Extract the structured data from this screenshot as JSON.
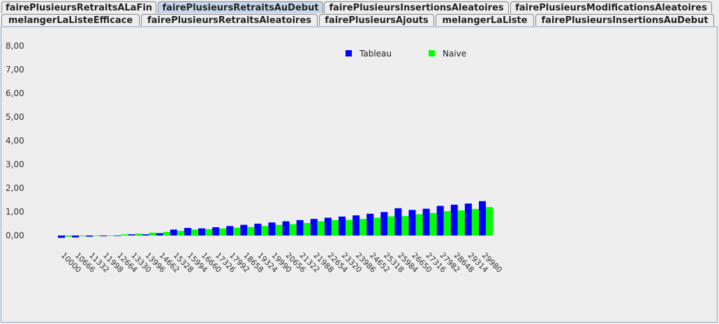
{
  "tabs_row1": [
    {
      "label": "fairePlusieursRetraitsALaFin",
      "selected": false
    },
    {
      "label": "fairePlusieursRetraitsAuDebut",
      "selected": true
    },
    {
      "label": "fairePlusieursInsertionsAleatoires",
      "selected": false
    },
    {
      "label": "fairePlusieursModificationsAleatoires",
      "selected": false
    }
  ],
  "tabs_row2": [
    {
      "label": "melangerLaListeEfficace",
      "selected": false
    },
    {
      "label": "fairePlusieursRetraitsAleatoires",
      "selected": false
    },
    {
      "label": "fairePlusieursAjouts",
      "selected": false
    },
    {
      "label": "melangerLaListe",
      "selected": false
    },
    {
      "label": "fairePlusieursInsertionsAuDebut",
      "selected": false
    }
  ],
  "chart_data": {
    "type": "bar",
    "categories": [
      "10000",
      "10666",
      "11332",
      "11998",
      "12664",
      "13330",
      "13996",
      "14662",
      "15328",
      "15994",
      "16660",
      "17326",
      "17992",
      "18658",
      "19324",
      "19990",
      "20656",
      "21322",
      "21988",
      "22654",
      "23320",
      "23986",
      "24652",
      "25318",
      "25984",
      "26650",
      "27316",
      "27982",
      "28648",
      "29314",
      "29980"
    ],
    "series": [
      {
        "name": "Tableau",
        "color": "#0000ff",
        "values": [
          -0.1,
          -0.08,
          -0.05,
          -0.03,
          0.0,
          0.05,
          0.05,
          0.1,
          0.25,
          0.32,
          0.3,
          0.35,
          0.4,
          0.45,
          0.5,
          0.55,
          0.6,
          0.65,
          0.7,
          0.75,
          0.8,
          0.85,
          0.92,
          0.99,
          1.15,
          1.08,
          1.13,
          1.25,
          1.3,
          1.35,
          1.45
        ]
      },
      {
        "name": "Naive",
        "color": "#00ff00",
        "values": [
          -0.05,
          -0.03,
          0.0,
          0.0,
          0.05,
          0.08,
          0.12,
          0.15,
          0.2,
          0.25,
          0.27,
          0.3,
          0.33,
          0.36,
          0.4,
          0.45,
          0.48,
          0.53,
          0.6,
          0.65,
          0.66,
          0.7,
          0.75,
          0.81,
          0.82,
          0.9,
          0.95,
          1.03,
          1.06,
          1.12,
          1.2
        ]
      }
    ],
    "y_ticks": [
      "8,00",
      "7,00",
      "6,00",
      "5,00",
      "4,00",
      "3,00",
      "2,00",
      "1,00",
      "0,00"
    ],
    "ylim": [
      0,
      8
    ],
    "legend_position": "top-center",
    "grid": false
  }
}
